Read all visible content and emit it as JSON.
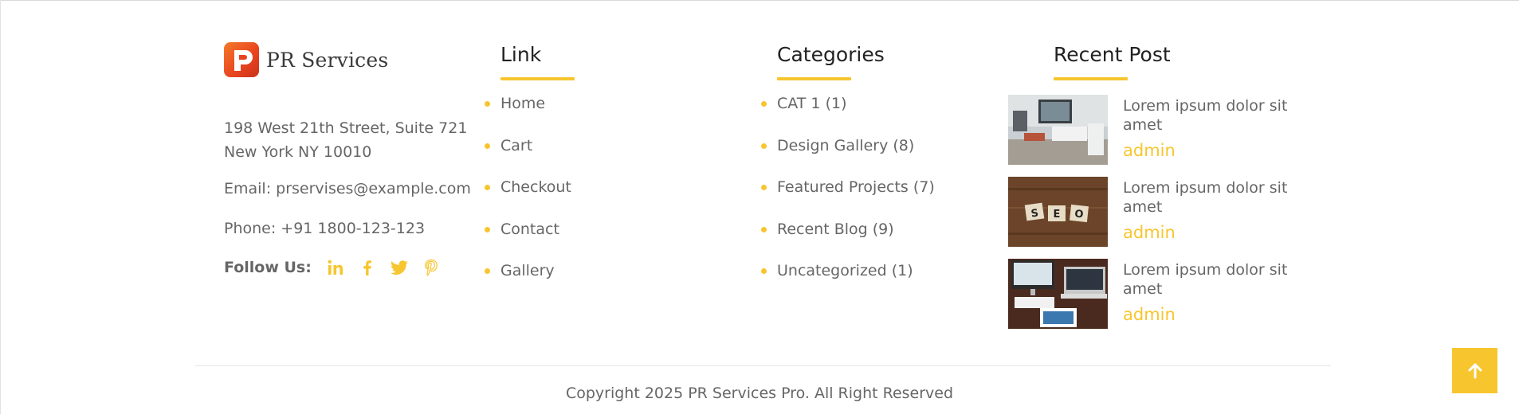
{
  "brand": {
    "name": "PR Services",
    "icon": "logo-icon"
  },
  "contact": {
    "address_line1": "198 West 21th Street, Suite 721",
    "address_line2": "New York NY 10010",
    "email": "Email: prservises@example.com",
    "phone": "Phone: +91 1800-123-123",
    "follow_label": "Follow Us:",
    "social": [
      "linkedin-icon",
      "facebook-icon",
      "twitter-icon",
      "pinterest-icon"
    ]
  },
  "links": {
    "heading": "Link",
    "items": [
      "Home",
      "Cart",
      "Checkout",
      "Contact",
      "Gallery"
    ]
  },
  "categories": {
    "heading": "Categories",
    "items": [
      "CAT 1 (1)",
      "Design Gallery (8)",
      "Featured Projects (7)",
      "Recent Blog (9)",
      "Uncategorized (1)"
    ]
  },
  "recent_posts": {
    "heading": "Recent Post",
    "items": [
      {
        "title": "Lorem ipsum dolor sit amet",
        "author": "admin"
      },
      {
        "title": "Lorem ipsum dolor sit amet",
        "author": "admin"
      },
      {
        "title": "Lorem ipsum dolor sit amet",
        "author": "admin"
      }
    ]
  },
  "footer": {
    "copyright": "Copyright 2025 PR Services Pro. All Right Reserved"
  },
  "colors": {
    "accent": "#f7c62f",
    "text": "#666666",
    "heading": "#222222"
  },
  "scroll_top": {
    "icon": "arrow-up-icon"
  }
}
